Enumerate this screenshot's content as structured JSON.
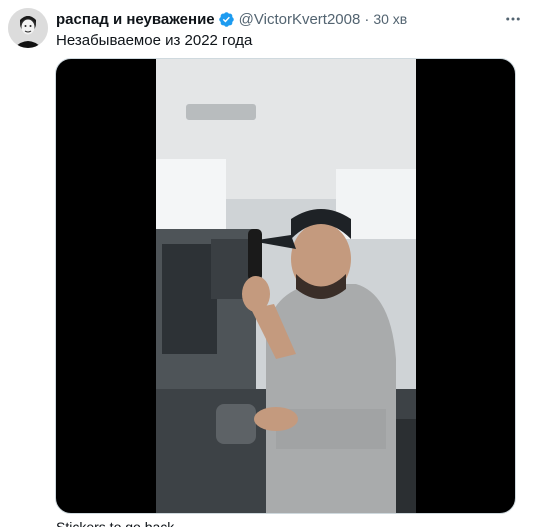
{
  "tweet": {
    "display_name": "распад и неуважение",
    "handle": "@VictorKvert2008",
    "separator": "·",
    "time": "30 хв",
    "text": "Незабываемое из 2022 года",
    "verified": true,
    "media": {
      "type": "video",
      "caption_cut": "Stickers to go back ..."
    }
  },
  "icons": {
    "avatar": "avatar-photo",
    "verified": "verified-badge-icon",
    "more": "more-dots-icon"
  },
  "colors": {
    "verified": "#1d9bf0",
    "secondary_text": "#536471",
    "primary_text": "#0f1419"
  }
}
